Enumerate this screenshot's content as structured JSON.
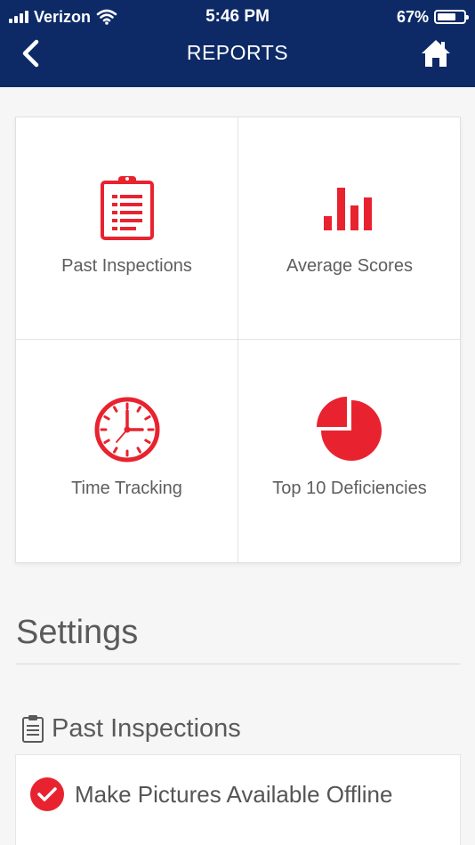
{
  "status_bar": {
    "carrier": "Verizon",
    "time": "5:46 PM",
    "battery": "67%"
  },
  "header": {
    "title": "REPORTS"
  },
  "tiles": [
    {
      "label": "Past Inspections",
      "icon": "clipboard-icon"
    },
    {
      "label": "Average Scores",
      "icon": "bar-chart-icon"
    },
    {
      "label": "Time Tracking",
      "icon": "clock-icon"
    },
    {
      "label": "Top 10 Deficiencies",
      "icon": "pie-chart-icon"
    }
  ],
  "settings": {
    "title": "Settings",
    "section": {
      "title": "Past Inspections",
      "icon": "clipboard-outline-icon"
    },
    "options": [
      {
        "label": "Make Pictures Available Offline",
        "checked": true
      }
    ]
  },
  "colors": {
    "header_bg": "#0d2a67",
    "accent": "#e8232f",
    "background": "#f6f6f6"
  }
}
